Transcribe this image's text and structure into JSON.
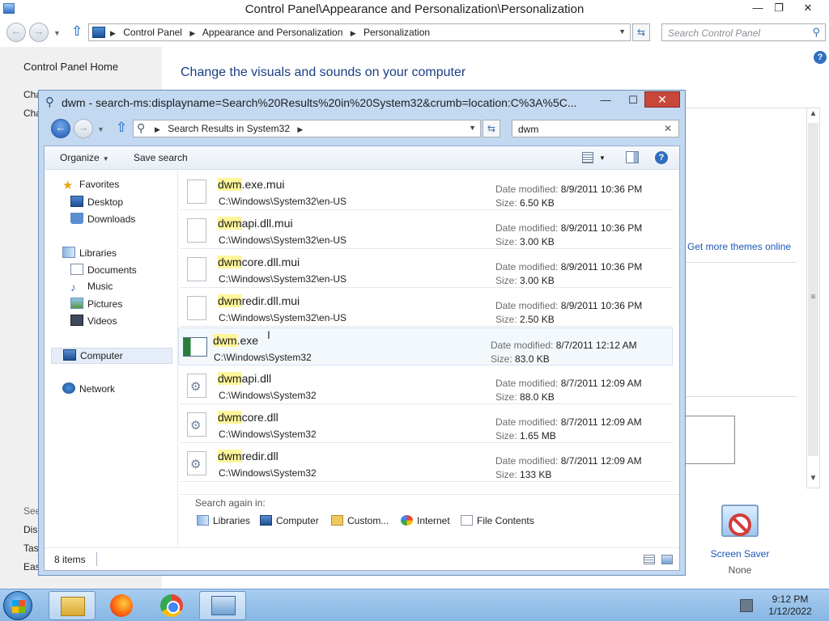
{
  "control_panel": {
    "window_title": "Control Panel\\Appearance and Personalization\\Personalization",
    "breadcrumbs": [
      "Control Panel",
      "Appearance and Personalization",
      "Personalization"
    ],
    "search_placeholder": "Search Control Panel",
    "left": {
      "home_link": "Control Panel Home",
      "fragments_top": [
        "Cha",
        "Cha"
      ],
      "see_also_fragment": "See",
      "fragments_bottom": [
        "Disp",
        "Tas",
        "Eas"
      ]
    },
    "heading": "Change the visuals and sounds on your computer",
    "themes_link": "Get more themes online",
    "screen_saver": {
      "label": "Screen Saver",
      "value": "None"
    }
  },
  "explorer": {
    "window_title": "dwm - search-ms:displayname=Search%20Results%20in%20System32&crumb=location:C%3A%5C...",
    "address": "Search Results in System32",
    "search_value": "dwm",
    "toolbar": {
      "organize": "Organize",
      "save_search": "Save search"
    },
    "nav": {
      "favorites": {
        "label": "Favorites",
        "items": [
          "Desktop",
          "Downloads"
        ]
      },
      "libraries": {
        "label": "Libraries",
        "items": [
          "Documents",
          "Music",
          "Pictures",
          "Videos"
        ]
      },
      "computer": "Computer",
      "network": "Network"
    },
    "results": [
      {
        "match": "dwm",
        "rest": ".exe.mui",
        "path": "C:\\Windows\\System32\\en-US",
        "date": "8/9/2011 10:36 PM",
        "size": "6.50 KB",
        "type": "doc"
      },
      {
        "match": "dwm",
        "rest": "api.dll.mui",
        "path": "C:\\Windows\\System32\\en-US",
        "date": "8/9/2011 10:36 PM",
        "size": "3.00 KB",
        "type": "doc"
      },
      {
        "match": "dwm",
        "rest": "core.dll.mui",
        "path": "C:\\Windows\\System32\\en-US",
        "date": "8/9/2011 10:36 PM",
        "size": "3.00 KB",
        "type": "doc"
      },
      {
        "match": "dwm",
        "rest": "redir.dll.mui",
        "path": "C:\\Windows\\System32\\en-US",
        "date": "8/9/2011 10:36 PM",
        "size": "2.50 KB",
        "type": "doc"
      },
      {
        "match": "dwm",
        "rest": ".exe",
        "path": "C:\\Windows\\System32",
        "date": "8/7/2011 12:12 AM",
        "size": "83.0 KB",
        "type": "exe"
      },
      {
        "match": "dwm",
        "rest": "api.dll",
        "path": "C:\\Windows\\System32",
        "date": "8/7/2011 12:09 AM",
        "size": "88.0 KB",
        "type": "dll"
      },
      {
        "match": "dwm",
        "rest": "core.dll",
        "path": "C:\\Windows\\System32",
        "date": "8/7/2011 12:09 AM",
        "size": "1.65 MB",
        "type": "dll"
      },
      {
        "match": "dwm",
        "rest": "redir.dll",
        "path": "C:\\Windows\\System32",
        "date": "8/7/2011 12:09 AM",
        "size": "133 KB",
        "type": "dll"
      }
    ],
    "date_label": "Date modified:",
    "size_label": "Size:",
    "search_again": {
      "label": "Search again in:",
      "items": [
        "Libraries",
        "Computer",
        "Custom...",
        "Internet",
        "File Contents"
      ]
    },
    "status": {
      "item_count": "8 items"
    }
  },
  "taskbar": {
    "clock": {
      "time": "9:12 PM",
      "date": "1/12/2022"
    }
  },
  "icons": {
    "start": "windows-start-icon",
    "folder": "file-explorer-icon",
    "firefox": "firefox-icon",
    "chrome": "chrome-icon",
    "control_panel": "control-panel-icon"
  }
}
